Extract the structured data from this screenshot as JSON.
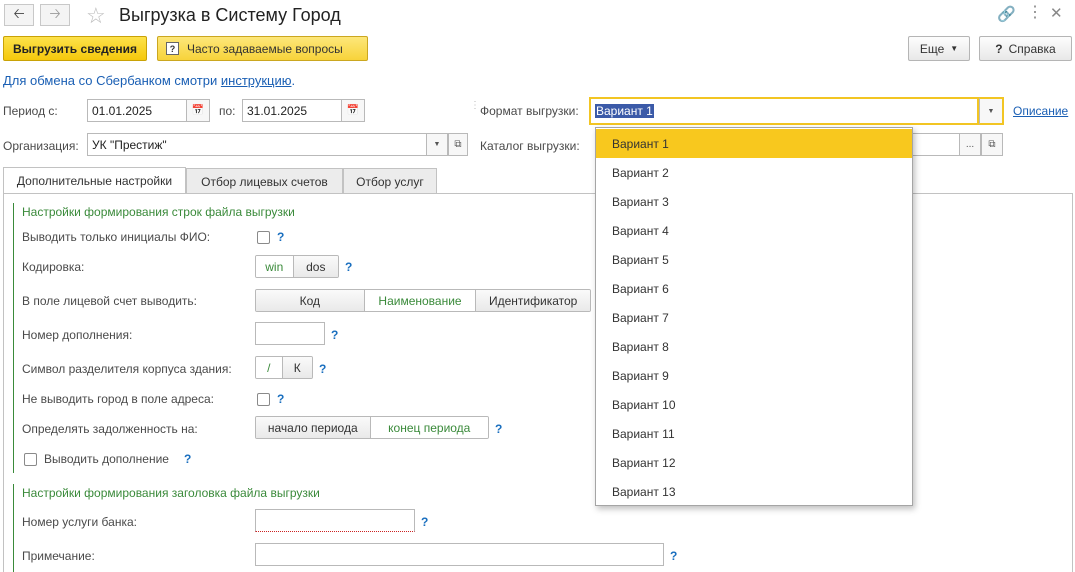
{
  "header": {
    "title": "Выгрузка в Систему Город",
    "back_icon": "arrow-left-icon",
    "forward_icon": "arrow-right-icon",
    "favorite_icon": "star-icon"
  },
  "toolbar": {
    "export_label": "Выгрузить сведения",
    "faq_label": "Часто задаваемые вопросы",
    "more_label": "Еще",
    "help_label": "Справка"
  },
  "info": {
    "text": "Для обмена со Сбербанком смотри ",
    "link": "инструкцию",
    "suffix": "."
  },
  "period": {
    "from_label": "Период с:",
    "from_value": "01.01.2025",
    "to_label": "по:",
    "to_value": "31.01.2025"
  },
  "org": {
    "label": "Организация:",
    "value": "УК \"Престиж\""
  },
  "format": {
    "label": "Формат выгрузки:",
    "value": "Вариант 1",
    "desc_link": "Описание",
    "options": [
      "Вариант 1",
      "Вариант 2",
      "Вариант 3",
      "Вариант 4",
      "Вариант 5",
      "Вариант 6",
      "Вариант 7",
      "Вариант 8",
      "Вариант 9",
      "Вариант 10",
      "Вариант 11",
      "Вариант 12",
      "Вариант 13"
    ]
  },
  "catalog": {
    "label": "Каталог выгрузки:"
  },
  "tabs": [
    "Дополнительные настройки",
    "Отбор лицевых счетов",
    "Отбор услуг"
  ],
  "rows": {
    "section1": "Настройки формирования строк файла выгрузки",
    "initials": "Выводить только инициалы ФИО:",
    "encoding": "Кодировка:",
    "enc_opts": [
      "win",
      "dos"
    ],
    "account": "В поле лицевой счет выводить:",
    "acc_opts": [
      "Код",
      "Наименование",
      "Идентификатор"
    ],
    "suppl": "Номер дополнения:",
    "separator": "Символ разделителя корпуса здания:",
    "sep_opts": [
      "/",
      "К"
    ],
    "no_city": "Не выводить город в поле адреса:",
    "debt": "Определять задолженность на:",
    "debt_opts": [
      "начало периода",
      "конец периода"
    ],
    "show_suppl": "Выводить дополнение",
    "section2": "Настройки формирования заголовка файла выгрузки",
    "bank_service": "Номер услуги банка:",
    "note": "Примечание:",
    "q": "?"
  }
}
